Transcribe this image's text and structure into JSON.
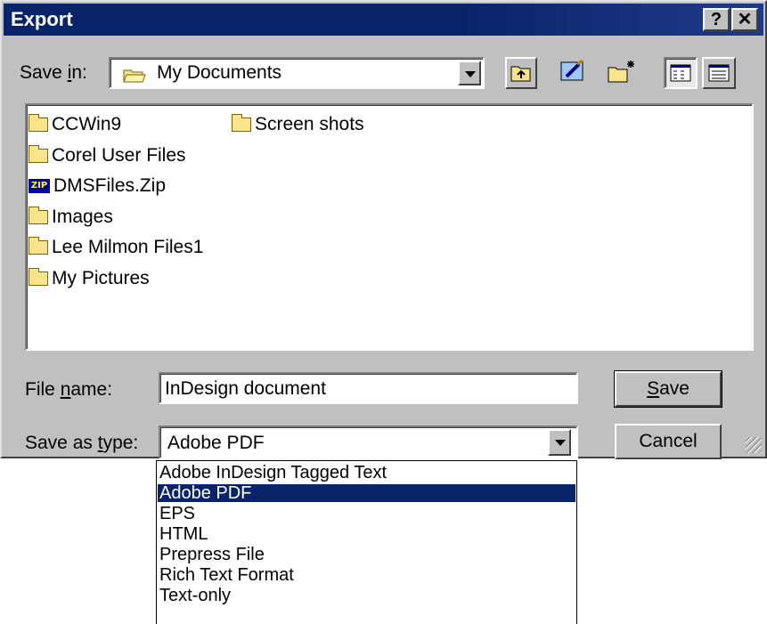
{
  "dialog": {
    "title": "Export",
    "help_label": "?",
    "close_label": "✕"
  },
  "save_in": {
    "label_pre": "Save ",
    "label_key": "i",
    "label_post": "n:",
    "value": "My Documents"
  },
  "toolbar": {
    "icons": [
      "up-folder-icon",
      "desktop-icon",
      "new-folder-icon",
      "list-view-icon",
      "details-view-icon"
    ]
  },
  "files": [
    {
      "name": "CCWin9",
      "type": "folder"
    },
    {
      "name": "Corel User Files",
      "type": "folder"
    },
    {
      "name": "DMSFiles.Zip",
      "type": "zip"
    },
    {
      "name": "Images",
      "type": "folder"
    },
    {
      "name": "Lee Milmon Files1",
      "type": "folder"
    },
    {
      "name": "My Pictures",
      "type": "folder"
    },
    {
      "name": "Screen shots",
      "type": "folder"
    }
  ],
  "zip_badge": "ZIP",
  "file_name": {
    "label_pre": "File ",
    "label_key": "n",
    "label_post": "ame:",
    "value": "InDesign document"
  },
  "save_as_type": {
    "label_pre": "Save as ",
    "label_key": "t",
    "label_post": "ype:",
    "value": "Adobe PDF",
    "options": [
      "Adobe InDesign Tagged Text",
      "Adobe PDF",
      "EPS",
      "HTML",
      "Prepress File",
      "Rich Text Format",
      "Text-only"
    ],
    "selected_index": 1
  },
  "buttons": {
    "save_key": "S",
    "save_rest": "ave",
    "cancel": "Cancel"
  },
  "colors": {
    "title_bar": "#0a246a",
    "face": "#c0c0c0",
    "selection": "#0a246a"
  }
}
